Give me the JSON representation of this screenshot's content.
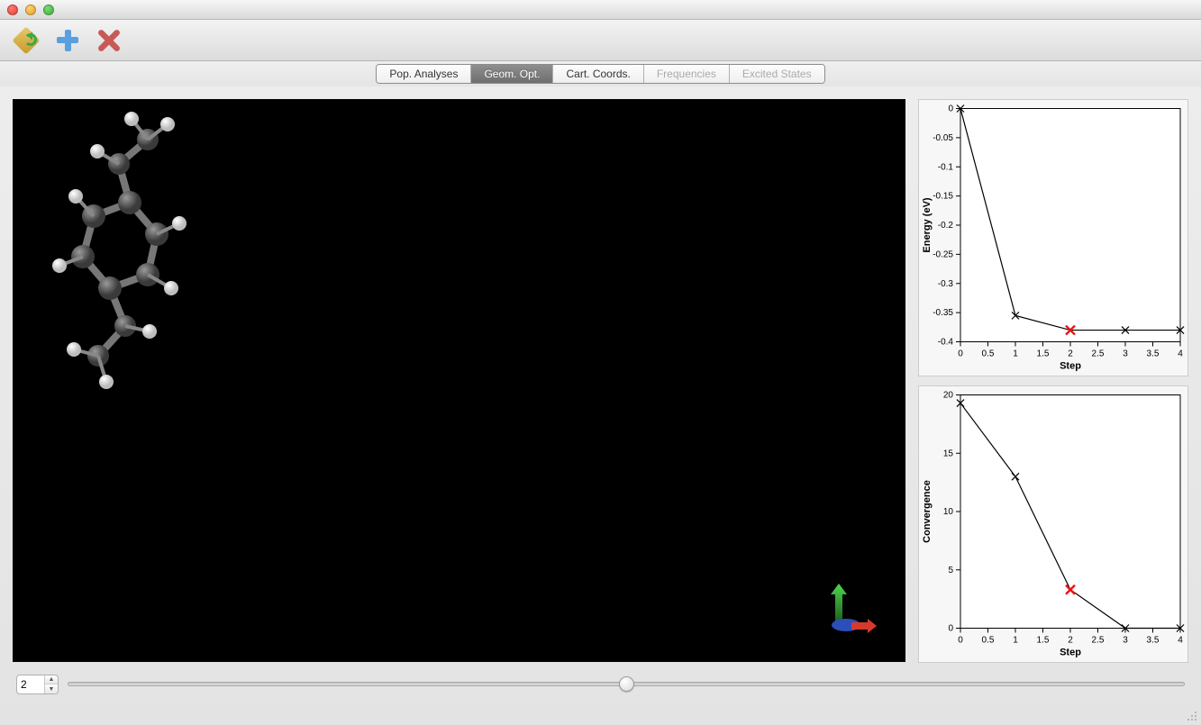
{
  "toolbar": {
    "reload_icon": "reload-icon",
    "add_icon": "plus-icon",
    "remove_icon": "x-icon"
  },
  "tabs": [
    {
      "id": "pop",
      "label": "Pop. Analyses",
      "selected": false,
      "enabled": true
    },
    {
      "id": "geom",
      "label": "Geom. Opt.",
      "selected": true,
      "enabled": true
    },
    {
      "id": "cart",
      "label": "Cart. Coords.",
      "selected": false,
      "enabled": true
    },
    {
      "id": "freq",
      "label": "Frequencies",
      "selected": false,
      "enabled": false
    },
    {
      "id": "excited",
      "label": "Excited States",
      "selected": false,
      "enabled": false
    }
  ],
  "step": {
    "value": "2",
    "min": 0,
    "max": 4,
    "slider_percent": 50
  },
  "chart_data": [
    {
      "type": "line",
      "title": "",
      "xlabel": "Step",
      "ylabel": "Energy (eV)",
      "x": [
        0,
        1,
        2,
        3,
        4
      ],
      "values": [
        0.0,
        -0.355,
        -0.38,
        -0.38,
        -0.38
      ],
      "highlight_index": 2,
      "xlim": [
        0,
        4
      ],
      "ylim": [
        -0.4,
        0
      ],
      "xticks": [
        0,
        0.5,
        1,
        1.5,
        2,
        2.5,
        3,
        3.5,
        4
      ],
      "yticks": [
        0,
        -0.05,
        -0.1,
        -0.15,
        -0.2,
        -0.25,
        -0.3,
        -0.35,
        -0.4
      ]
    },
    {
      "type": "line",
      "title": "",
      "xlabel": "Step",
      "ylabel": "Convergence",
      "x": [
        0,
        1,
        2,
        3,
        4
      ],
      "values": [
        19.3,
        13.0,
        3.3,
        0.0,
        0.0
      ],
      "highlight_index": 2,
      "xlim": [
        0,
        4
      ],
      "ylim": [
        0,
        20
      ],
      "xticks": [
        0,
        0.5,
        1,
        1.5,
        2,
        2.5,
        3,
        3.5,
        4
      ],
      "yticks": [
        0,
        5,
        10,
        15,
        20
      ]
    }
  ]
}
